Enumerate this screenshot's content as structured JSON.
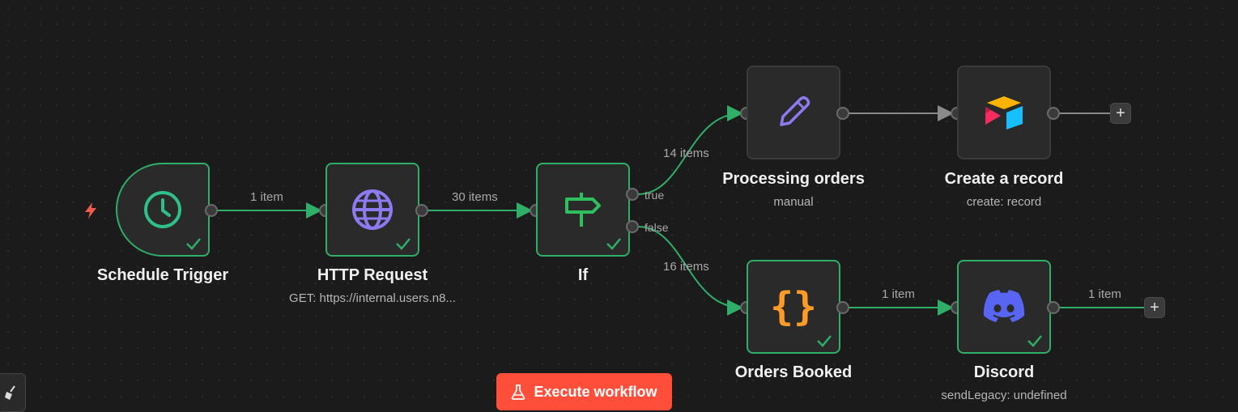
{
  "nodes": {
    "schedule_trigger": {
      "title": "Schedule Trigger",
      "subtitle": ""
    },
    "http_request": {
      "title": "HTTP Request",
      "subtitle": "GET: https://internal.users.n8..."
    },
    "if": {
      "title": "If",
      "subtitle": "",
      "true_label": "true",
      "false_label": "false"
    },
    "processing_orders": {
      "title": "Processing orders",
      "subtitle": "manual"
    },
    "create_record": {
      "title": "Create a record",
      "subtitle": "create: record"
    },
    "orders_booked": {
      "title": "Orders Booked",
      "subtitle": ""
    },
    "discord": {
      "title": "Discord",
      "subtitle": "sendLegacy: undefined"
    }
  },
  "edges": {
    "trigger_to_http": "1 item",
    "http_to_if": "30 items",
    "if_true": "14 items",
    "if_false": "16 items",
    "orders_to_discord": "1 item",
    "discord_out": "1 item"
  },
  "toolbar": {
    "execute_label": "Execute workflow",
    "plus_label": "+"
  },
  "colors": {
    "success": "#2fae67",
    "execute": "#ff4f3b",
    "http_icon": "#8c7bf0",
    "code_icon": "#ff9b26",
    "discord_icon": "#5865f2",
    "trigger_icon": "#2fbf8a"
  }
}
